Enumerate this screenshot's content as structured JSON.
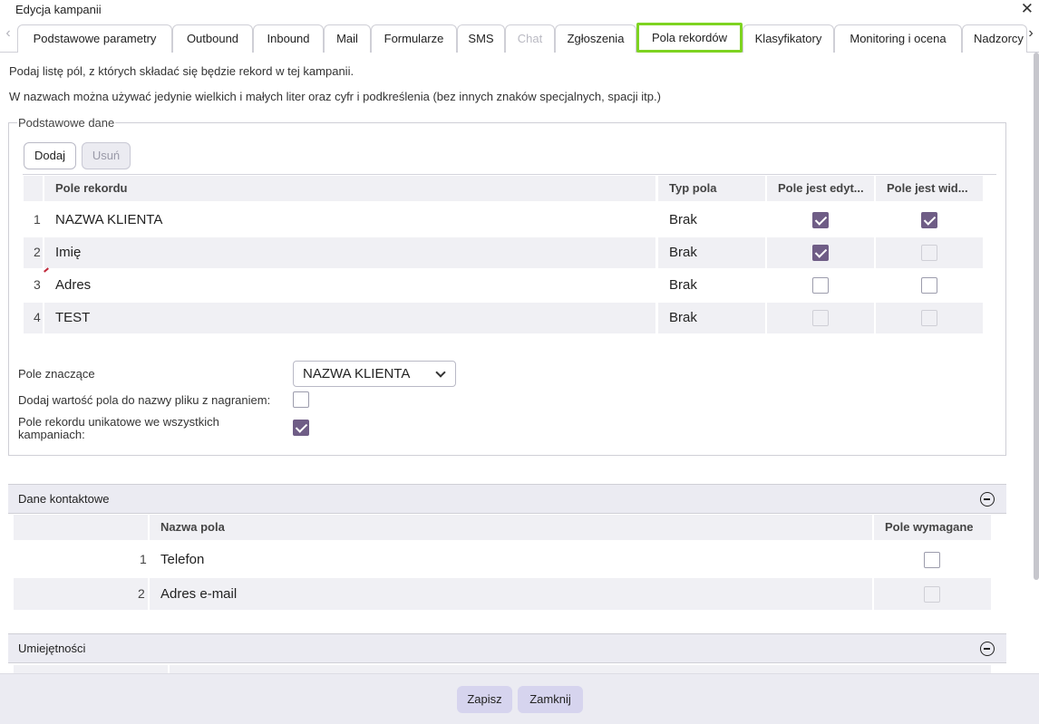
{
  "window": {
    "title": "Edycja kampanii"
  },
  "tabs": [
    {
      "label": "Podstawowe parametry"
    },
    {
      "label": "Outbound"
    },
    {
      "label": "Inbound"
    },
    {
      "label": "Mail"
    },
    {
      "label": "Formularze"
    },
    {
      "label": "SMS"
    },
    {
      "label": "Chat"
    },
    {
      "label": "Zgłoszenia"
    },
    {
      "label": "Pola rekordów"
    },
    {
      "label": "Klasyfikatory"
    },
    {
      "label": "Monitoring i ocena"
    },
    {
      "label": "Nadzorcy"
    }
  ],
  "active_tab": "Pola rekordów",
  "info": {
    "line1": "Podaj listę pól, z których składać się będzie rekord w tej kampanii.",
    "line2": "W nazwach można używać jedynie wielkich i małych liter oraz cyfr i podkreślenia (bez innych znaków specjalnych, spacji itp.)"
  },
  "basic": {
    "legend": "Podstawowe dane",
    "add_label": "Dodaj",
    "remove_label": "Usuń",
    "columns": [
      "Pole rekordu",
      "Typ pola",
      "Pole jest edyt...",
      "Pole jest wid..."
    ],
    "rows": [
      {
        "num": "1",
        "name": "NAZWA KLIENTA",
        "type": "Brak",
        "editable": true,
        "visible": true
      },
      {
        "num": "2",
        "name": "Imię",
        "type": "Brak",
        "editable": true,
        "visible": false
      },
      {
        "num": "3",
        "name": "Adres",
        "type": "Brak",
        "editable": false,
        "visible": false
      },
      {
        "num": "4",
        "name": "TEST",
        "type": "Brak",
        "editable": false,
        "visible": false
      }
    ],
    "significant_label": "Pole znaczące",
    "significant_value": "NAZWA KLIENTA",
    "add_to_filename_label": "Dodaj wartość pola do nazwy pliku z nagraniem:",
    "add_to_filename_checked": false,
    "unique_label_1": "Pole rekordu unikatowe we wszystkich",
    "unique_label_2": "kampaniach:",
    "unique_checked": true
  },
  "contact": {
    "title": "Dane kontaktowe",
    "columns": [
      "Nazwa pola",
      "Pole wymagane"
    ],
    "rows": [
      {
        "num": "1",
        "name": "Telefon",
        "required": false
      },
      {
        "num": "2",
        "name": "Adres e-mail",
        "required": false
      }
    ]
  },
  "skills": {
    "title": "Umiejętności"
  },
  "footer": {
    "save_label": "Zapisz",
    "close_label": "Zamknij"
  },
  "colors": {
    "accent": "#6f5d86",
    "active_tab_border": "#7ed321",
    "footer_button": "#d6d4ee"
  }
}
